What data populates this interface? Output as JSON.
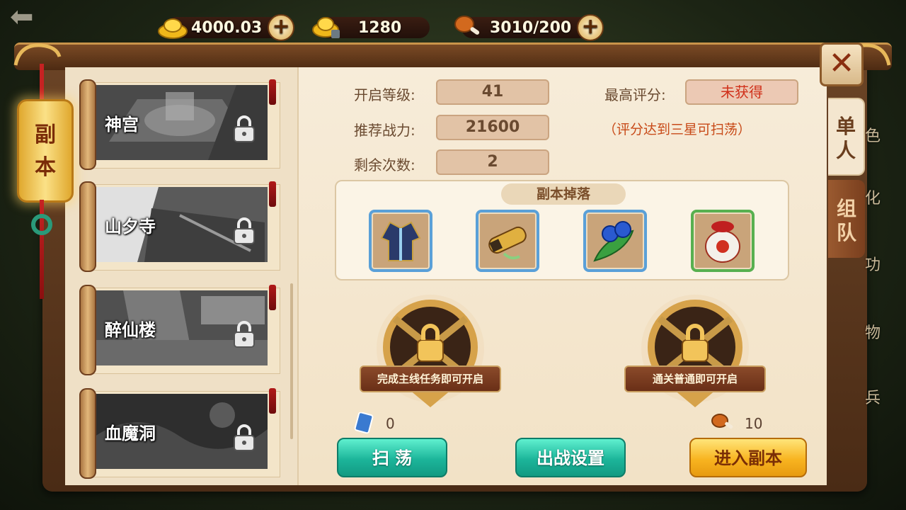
{
  "resources": {
    "gold": "4000.03",
    "ingot": "1280",
    "stamina": "3010/200"
  },
  "side_tab_label": [
    "副",
    "本"
  ],
  "dungeons": [
    {
      "name": "神宫"
    },
    {
      "name": "山夕寺"
    },
    {
      "name": "醉仙楼"
    },
    {
      "name": "血魔洞"
    }
  ],
  "info": {
    "level_label": "开启等级:",
    "level_value": "41",
    "power_label": "推荐战力:",
    "power_value": "21600",
    "remaining_label": "剩余次数:",
    "remaining_value": "2",
    "best_label": "最高评分:",
    "best_value": "未获得",
    "hint": "（评分达到三星可扫荡）"
  },
  "drops": {
    "title": "副本掉落",
    "items": [
      "robe",
      "scroll",
      "berries",
      "wine-jar"
    ]
  },
  "medals": {
    "left": "完成主线任务即可开启",
    "right": "通关普通即可开启"
  },
  "costs": {
    "sweep_ticket": "0",
    "stamina": "10"
  },
  "buttons": {
    "sweep": "扫 荡",
    "battle_setup": "出战设置",
    "enter": "进入副本"
  },
  "tabs": {
    "single": [
      "单",
      "人"
    ],
    "team": [
      "组",
      "队"
    ]
  },
  "close_label": "✕",
  "background_side": [
    "色",
    "化",
    "功",
    "物",
    "兵"
  ],
  "colors": {
    "accent_gold": "#f8b420",
    "teal_button": "#1cb59a",
    "red_text": "#d0301a"
  }
}
